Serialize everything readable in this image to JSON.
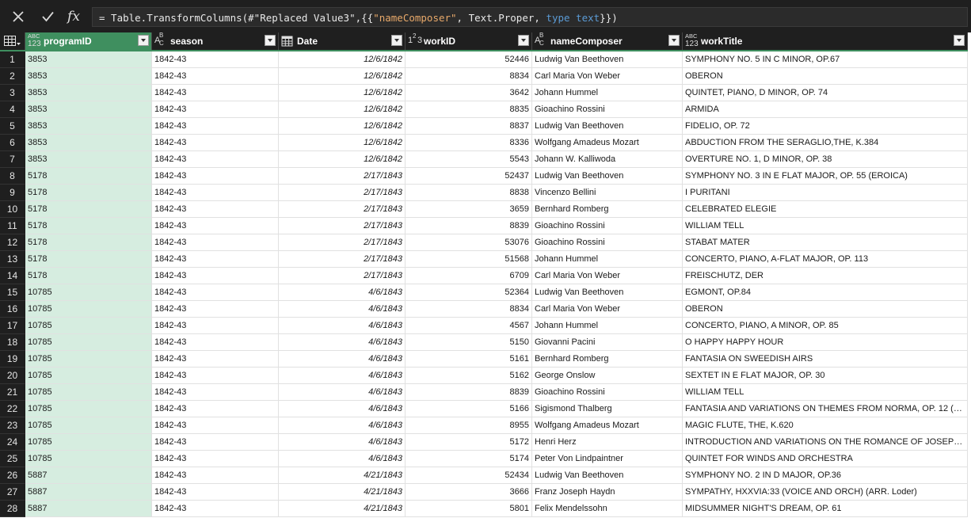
{
  "formula": {
    "prefix": "= Table.TransformColumns(#\"Replaced Value3\",{{",
    "str1": "\"nameComposer\"",
    "mid": ", Text.Proper, ",
    "kw": "type text",
    "suffix": "}})"
  },
  "columns": [
    {
      "name": "programID",
      "type": "any"
    },
    {
      "name": "season",
      "type": "text"
    },
    {
      "name": "Date",
      "type": "date"
    },
    {
      "name": "workID",
      "type": "number"
    },
    {
      "name": "nameComposer",
      "type": "text"
    },
    {
      "name": "workTitle",
      "type": "any"
    }
  ],
  "selected_column": "programID",
  "rows": [
    [
      "1",
      "3853",
      "1842-43",
      "12/6/1842",
      "52446",
      "Ludwig Van Beethoven",
      "SYMPHONY NO. 5 IN C MINOR, OP.67"
    ],
    [
      "2",
      "3853",
      "1842-43",
      "12/6/1842",
      "8834",
      "Carl Maria Von Weber",
      "OBERON"
    ],
    [
      "3",
      "3853",
      "1842-43",
      "12/6/1842",
      "3642",
      "Johann Hummel",
      "QUINTET, PIANO, D MINOR, OP. 74"
    ],
    [
      "4",
      "3853",
      "1842-43",
      "12/6/1842",
      "8835",
      "Gioachino Rossini",
      "ARMIDA"
    ],
    [
      "5",
      "3853",
      "1842-43",
      "12/6/1842",
      "8837",
      "Ludwig Van Beethoven",
      "FIDELIO, OP. 72"
    ],
    [
      "6",
      "3853",
      "1842-43",
      "12/6/1842",
      "8336",
      "Wolfgang Amadeus Mozart",
      "ABDUCTION FROM THE SERAGLIO,THE, K.384"
    ],
    [
      "7",
      "3853",
      "1842-43",
      "12/6/1842",
      "5543",
      "Johann W. Kalliwoda",
      "OVERTURE NO. 1, D MINOR, OP. 38"
    ],
    [
      "8",
      "5178",
      "1842-43",
      "2/17/1843",
      "52437",
      "Ludwig Van Beethoven",
      "SYMPHONY NO. 3 IN E FLAT MAJOR, OP. 55 (EROICA)"
    ],
    [
      "9",
      "5178",
      "1842-43",
      "2/17/1843",
      "8838",
      "Vincenzo Bellini",
      "I PURITANI"
    ],
    [
      "10",
      "5178",
      "1842-43",
      "2/17/1843",
      "3659",
      "Bernhard Romberg",
      "CELEBRATED ELEGIE"
    ],
    [
      "11",
      "5178",
      "1842-43",
      "2/17/1843",
      "8839",
      "Gioachino Rossini",
      "WILLIAM TELL"
    ],
    [
      "12",
      "5178",
      "1842-43",
      "2/17/1843",
      "53076",
      "Gioachino Rossini",
      "STABAT MATER"
    ],
    [
      "13",
      "5178",
      "1842-43",
      "2/17/1843",
      "51568",
      "Johann Hummel",
      "CONCERTO, PIANO, A-FLAT MAJOR, OP. 113"
    ],
    [
      "14",
      "5178",
      "1842-43",
      "2/17/1843",
      "6709",
      "Carl Maria Von Weber",
      "FREISCHUTZ, DER"
    ],
    [
      "15",
      "10785",
      "1842-43",
      "4/6/1843",
      "52364",
      "Ludwig Van Beethoven",
      "EGMONT, OP.84"
    ],
    [
      "16",
      "10785",
      "1842-43",
      "4/6/1843",
      "8834",
      "Carl Maria Von Weber",
      "OBERON"
    ],
    [
      "17",
      "10785",
      "1842-43",
      "4/6/1843",
      "4567",
      "Johann Hummel",
      "CONCERTO, PIANO, A MINOR, OP. 85"
    ],
    [
      "18",
      "10785",
      "1842-43",
      "4/6/1843",
      "5150",
      "Giovanni Pacini",
      "O HAPPY HAPPY HOUR"
    ],
    [
      "19",
      "10785",
      "1842-43",
      "4/6/1843",
      "5161",
      "Bernhard Romberg",
      "FANTASIA ON SWEEDISH AIRS"
    ],
    [
      "20",
      "10785",
      "1842-43",
      "4/6/1843",
      "5162",
      "George Onslow",
      "SEXTET IN E FLAT MAJOR, OP. 30"
    ],
    [
      "21",
      "10785",
      "1842-43",
      "4/6/1843",
      "8839",
      "Gioachino Rossini",
      "WILLIAM TELL"
    ],
    [
      "22",
      "10785",
      "1842-43",
      "4/6/1843",
      "5166",
      "Sigismond Thalberg",
      "FANTASIA AND VARIATIONS ON THEMES FROM NORMA, OP. 12 (FOU..."
    ],
    [
      "23",
      "10785",
      "1842-43",
      "4/6/1843",
      "8955",
      "Wolfgang Amadeus Mozart",
      "MAGIC FLUTE, THE, K.620"
    ],
    [
      "24",
      "10785",
      "1842-43",
      "4/6/1843",
      "5172",
      "Henri Herz",
      "INTRODUCTION AND VARIATIONS ON THE ROMANCE OF JOSEPH, OP. ..."
    ],
    [
      "25",
      "10785",
      "1842-43",
      "4/6/1843",
      "5174",
      "Peter Von Lindpaintner",
      "QUINTET FOR WINDS AND ORCHESTRA"
    ],
    [
      "26",
      "5887",
      "1842-43",
      "4/21/1843",
      "52434",
      "Ludwig Van Beethoven",
      "SYMPHONY NO. 2 IN D MAJOR, OP.36"
    ],
    [
      "27",
      "5887",
      "1842-43",
      "4/21/1843",
      "3666",
      "Franz Joseph Haydn",
      "SYMPATHY, HXXVIA:33 (VOICE AND ORCH) (ARR. Loder)"
    ],
    [
      "28",
      "5887",
      "1842-43",
      "4/21/1843",
      "5801",
      "Felix Mendelssohn",
      "MIDSUMMER NIGHT'S DREAM, OP. 61"
    ]
  ],
  "colors": {
    "accent_green": "#3f8f5f",
    "selected_column_bg": "#d6ede0",
    "chrome_dark": "#1f1f1f"
  }
}
